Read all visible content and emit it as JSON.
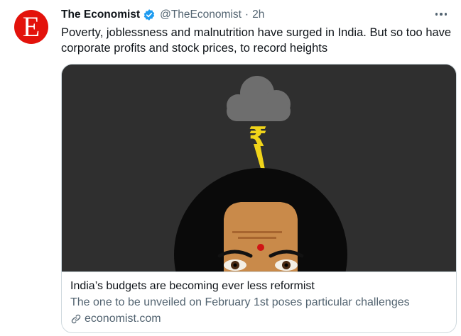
{
  "tweet": {
    "author_name": "The Economist",
    "handle": "@TheEconomist",
    "separator": "·",
    "time": "2h",
    "avatar_letter": "E",
    "text": "Poverty, joblessness and malnutrition have surged in India. But so too have corporate profits and stock prices, to record heights",
    "icons": {
      "verified": "verified-badge-icon",
      "more": "more-options-icon",
      "link": "link-icon"
    }
  },
  "card": {
    "title": "India’s budgets are becoming ever less reformist",
    "description": "The one to be unveiled on February 1st poses particular challenges",
    "domain": "economist.com",
    "image": {
      "rupee_symbol": "₹"
    }
  },
  "colors": {
    "brand_red": "#e3120b",
    "verified_blue": "#1d9bf0",
    "secondary_text": "#536471",
    "image_background": "#2f2f2f",
    "bolt_yellow": "#f0d41a"
  }
}
